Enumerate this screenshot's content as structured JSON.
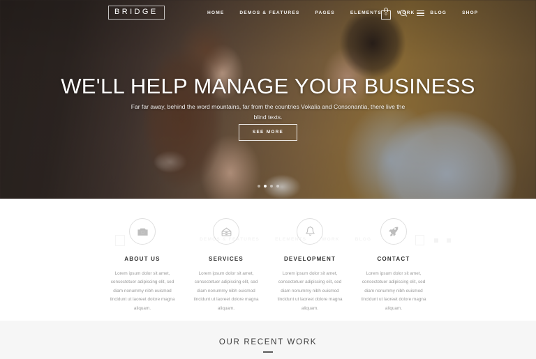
{
  "site": {
    "logo_text": "BRIDGE"
  },
  "header": {
    "nav_items": [
      {
        "label": "HOME",
        "name": "nav-home"
      },
      {
        "label": "DEMOS & FEATURES",
        "name": "nav-demos-features"
      },
      {
        "label": "PAGES",
        "name": "nav-pages"
      },
      {
        "label": "ELEMENTS",
        "name": "nav-elements"
      },
      {
        "label": "WORK",
        "name": "nav-work"
      },
      {
        "label": "BLOG",
        "name": "nav-blog"
      },
      {
        "label": "SHOP",
        "name": "nav-shop"
      }
    ],
    "cart_count": "0",
    "search_icon": "search-icon",
    "menu_icon": "hamburger-menu-icon",
    "cart_icon": "shopping-bag-icon"
  },
  "hero": {
    "title": "WE'LL HELP MANAGE YOUR BUSINESS",
    "subtitle": "Far far away, behind the word mountains, far from the countries Vokalia and Consonantia, there live the blind texts.",
    "button_label": "SEE MORE",
    "slide_count": 4,
    "active_slide": 2
  },
  "features": [
    {
      "icon": "camera-icon",
      "title": "ABOUT US",
      "text": "Lorem ipsum dolor sit amet, consectetuer adipiscing elit, sed diam nonummy nibh euismod tincidunt ut laoreet dolore magna aliquam."
    },
    {
      "icon": "drawer-icon",
      "title": "SERVICES",
      "text": "Lorem ipsum dolor sit amet, consectetuer adipiscing elit, sed diam nonummy nibh euismod tincidunt ut laoreet dolore magna aliquam."
    },
    {
      "icon": "bell-icon",
      "title": "DEVELOPMENT",
      "text": "Lorem ipsum dolor sit amet, consectetuer adipiscing elit, sed diam nonummy nibh euismod tincidunt ut laoreet dolore magna aliquam."
    },
    {
      "icon": "rocket-icon",
      "title": "CONTACT",
      "text": "Lorem ipsum dolor sit amet, consectetuer adipiscing elit, sed diam nonummy nibh euismod tincidunt ut laoreet dolore magna aliquam."
    }
  ],
  "recent_work": {
    "title": "OUR RECENT WORK"
  },
  "colors": {
    "hero_text": "#ffffff",
    "feature_title": "#2f2f2f",
    "feature_text": "#9b9b9b",
    "recent_bg": "#f6f6f6",
    "icon_stroke": "#bdbdbd",
    "circle_border": "#e0e0e0"
  }
}
